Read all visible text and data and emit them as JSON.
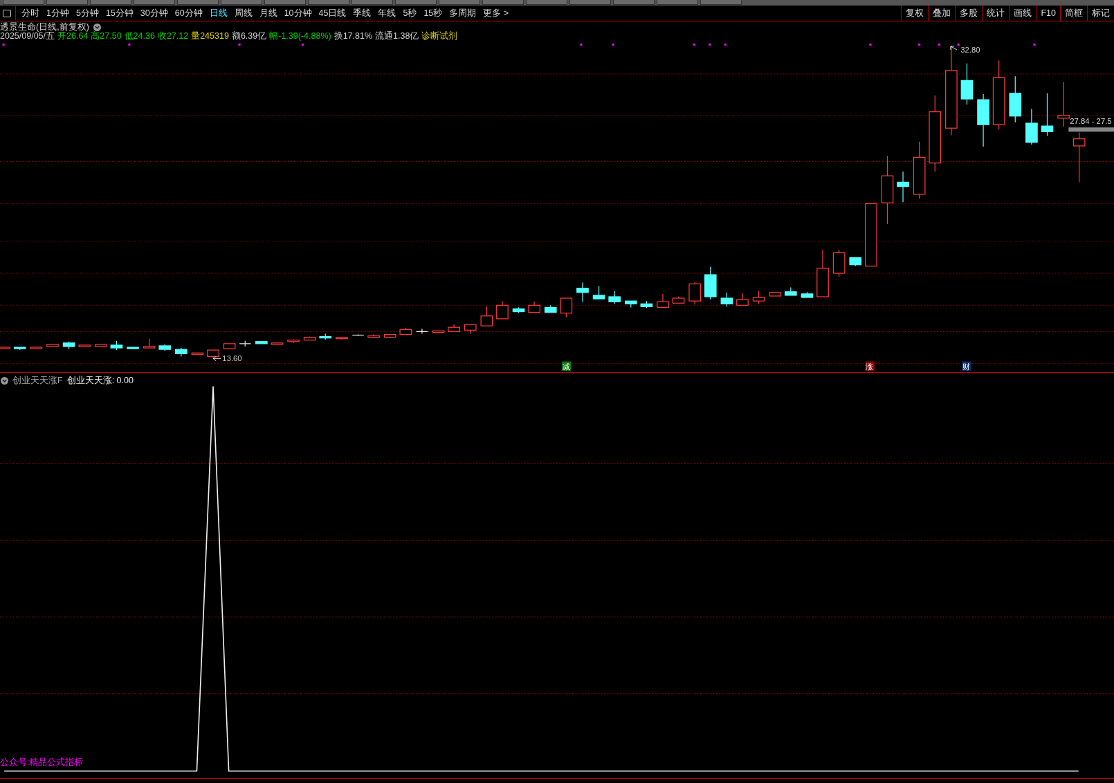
{
  "toolbar": {
    "periods": [
      {
        "label": "分时",
        "selected": false
      },
      {
        "label": "1分钟",
        "selected": false
      },
      {
        "label": "5分钟",
        "selected": false
      },
      {
        "label": "15分钟",
        "selected": false
      },
      {
        "label": "30分钟",
        "selected": false
      },
      {
        "label": "60分钟",
        "selected": false
      },
      {
        "label": "日线",
        "selected": true
      },
      {
        "label": "周线",
        "selected": false
      },
      {
        "label": "月线",
        "selected": false
      },
      {
        "label": "10分钟",
        "selected": false
      },
      {
        "label": "45日线",
        "selected": false
      },
      {
        "label": "季线",
        "selected": false
      },
      {
        "label": "年线",
        "selected": false
      },
      {
        "label": "5秒",
        "selected": false
      },
      {
        "label": "15秒",
        "selected": false
      },
      {
        "label": "多周期",
        "selected": false
      },
      {
        "label": "更多 >",
        "selected": false
      }
    ],
    "tools": [
      "复权",
      "叠加",
      "多股",
      "统计",
      "画线",
      "F10",
      "简框",
      "标记"
    ]
  },
  "stock": {
    "title": "透景生命(日线,前复权)",
    "date": "2025/09/05/五",
    "quotes": [
      {
        "text": "开26.64",
        "color": "#00d000"
      },
      {
        "text": "高27.50",
        "color": "#00d000"
      },
      {
        "text": "低24.36",
        "color": "#00d000"
      },
      {
        "text": "收27.12",
        "color": "#00d000"
      },
      {
        "text": "量245319",
        "color": "#e0d000"
      },
      {
        "text": "额6.39亿",
        "color": "#d0d0d0"
      },
      {
        "text": "幅-1.39(-4.88%)",
        "color": "#00d000"
      },
      {
        "text": "换17.81%",
        "color": "#d0d0d0"
      },
      {
        "text": "流通1.38亿",
        "color": "#d0d0d0"
      },
      {
        "text": "诊断试剂",
        "color": "#e0d000"
      }
    ]
  },
  "chart": {
    "high_label": "32.80",
    "low_label": "13.60",
    "price_tag": "27.84 - 27.5",
    "events": [
      {
        "label": "减",
        "color": "#0b7a0b"
      },
      {
        "label": "涨",
        "color": "#8a0a0a"
      },
      {
        "label": "财",
        "color": "#10306a"
      }
    ]
  },
  "indicator": {
    "name": "创业天天涨F",
    "reading": "创业天天涨: 0.00",
    "footer": "公众号:精品公式指标"
  }
}
